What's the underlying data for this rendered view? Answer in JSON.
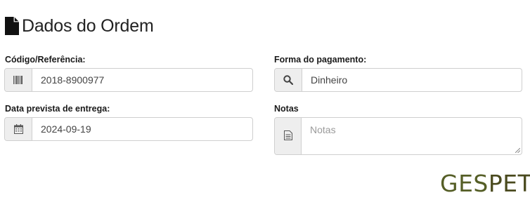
{
  "section": {
    "title": "Dados do Ordem",
    "icon": "file-icon"
  },
  "fields": {
    "codigo": {
      "label": "Código/Referência:",
      "value": "2018-8900977",
      "icon": "barcode-icon"
    },
    "forma_pagamento": {
      "label": "Forma do pagamento:",
      "value": "Dinheiro",
      "icon": "search-icon"
    },
    "data_entrega": {
      "label": "Data prevista de entrega:",
      "value": "2024-09-19",
      "icon": "calendar-icon"
    },
    "notas": {
      "label": "Notas",
      "placeholder": "Notas",
      "value": "",
      "icon": "document-icon"
    }
  },
  "logo": {
    "part1": "GES",
    "part2": "PET",
    "colors": {
      "part1": "#555e26",
      "part2": "#4a4a1e"
    }
  }
}
